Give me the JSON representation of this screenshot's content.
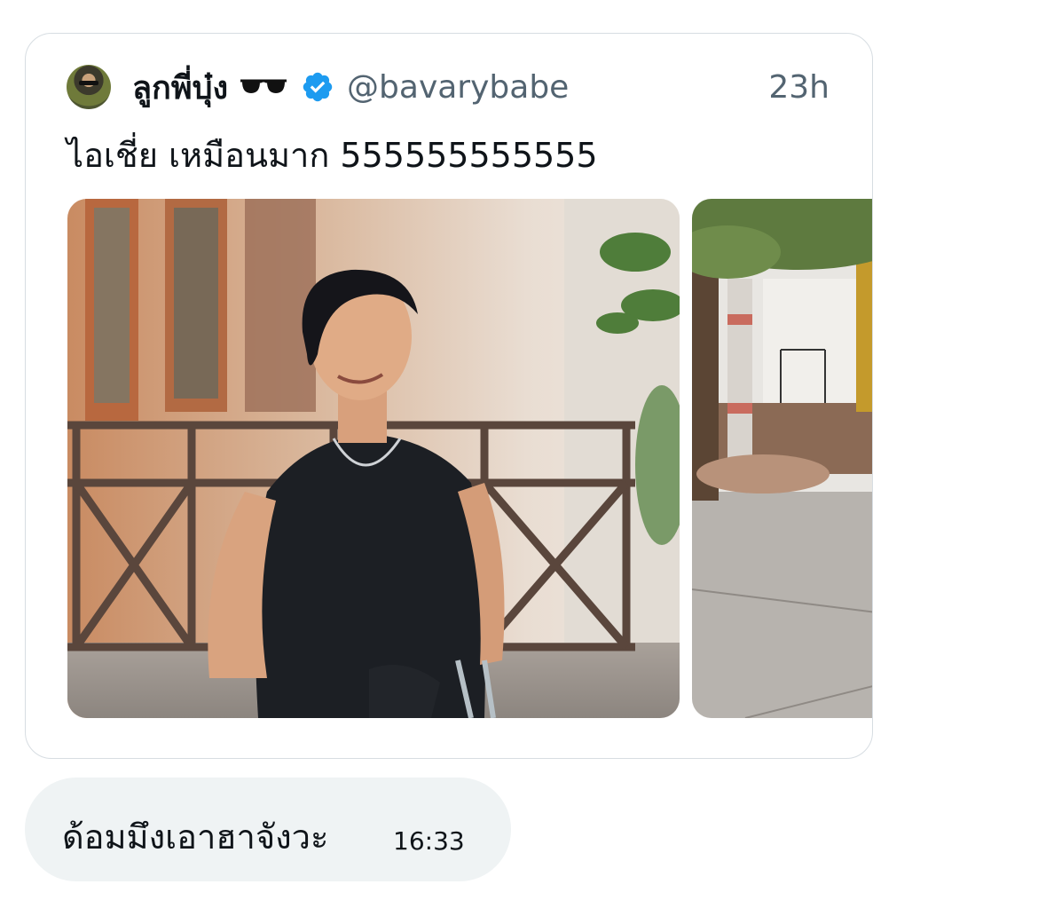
{
  "tweet": {
    "author_name": "ลูกพี่บุ๋ง",
    "author_handle": "@bavarybabe",
    "timestamp": "23h",
    "text": "ไอเชี่ย เหมือนมาก 555555555555",
    "verified": true,
    "name_emoji": "sunglasses-icon",
    "accent_color": "#1d9bf0"
  },
  "message": {
    "text": "ด้อมมึงเอาฮาจังวะ",
    "time": "16:33",
    "bubble_color": "#eff3f4"
  }
}
